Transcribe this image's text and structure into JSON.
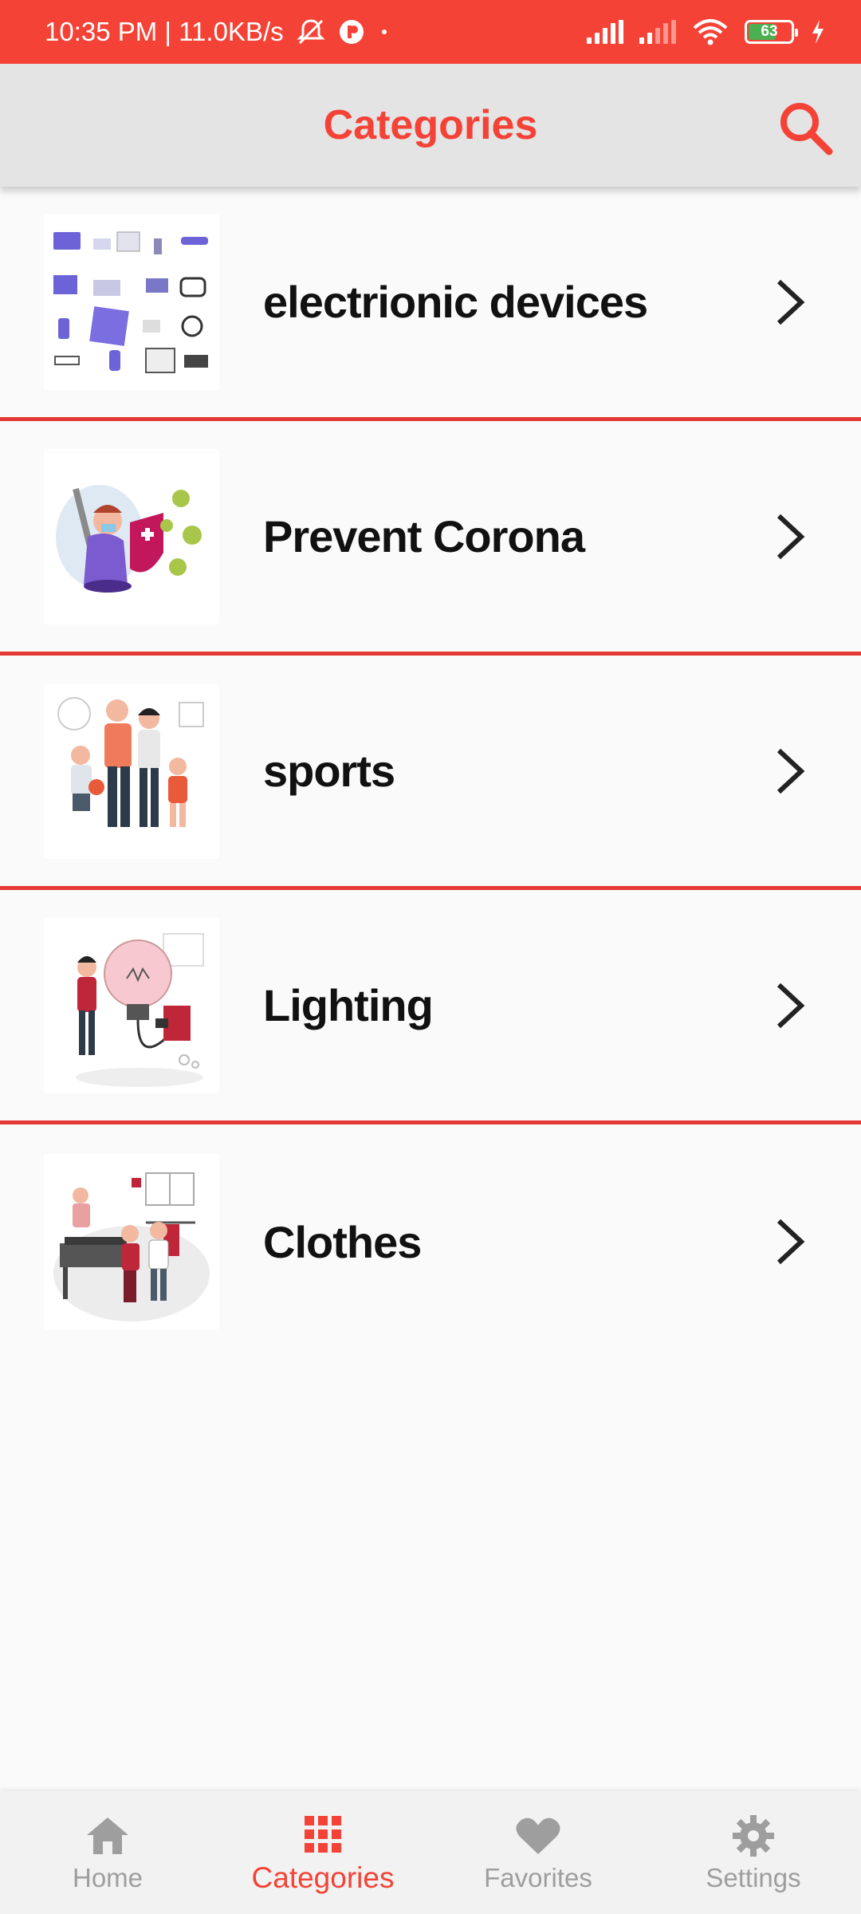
{
  "status_bar": {
    "time_speed": "10:35 PM | 11.0KB/s",
    "battery_level": "63"
  },
  "app_bar": {
    "title": "Categories",
    "search_icon": "search-icon"
  },
  "categories": [
    {
      "label": "electrionic devices",
      "image": "electronic-devices-illustration"
    },
    {
      "label": "Prevent Corona",
      "image": "prevent-corona-illustration"
    },
    {
      "label": "sports",
      "image": "sports-family-illustration"
    },
    {
      "label": "Lighting",
      "image": "lighting-bulb-illustration"
    },
    {
      "label": "Clothes",
      "image": "clothes-shop-illustration"
    }
  ],
  "bottom_nav": {
    "items": [
      {
        "label": "Home",
        "icon": "home-icon",
        "active": false
      },
      {
        "label": "Categories",
        "icon": "grid-icon",
        "active": true
      },
      {
        "label": "Favorites",
        "icon": "heart-icon",
        "active": false
      },
      {
        "label": "Settings",
        "icon": "gear-icon",
        "active": false
      }
    ]
  },
  "colors": {
    "accent": "#f44336",
    "divider": "#e53935",
    "app_bar_bg": "#e4e4e4",
    "inactive": "#9e9e9e"
  }
}
